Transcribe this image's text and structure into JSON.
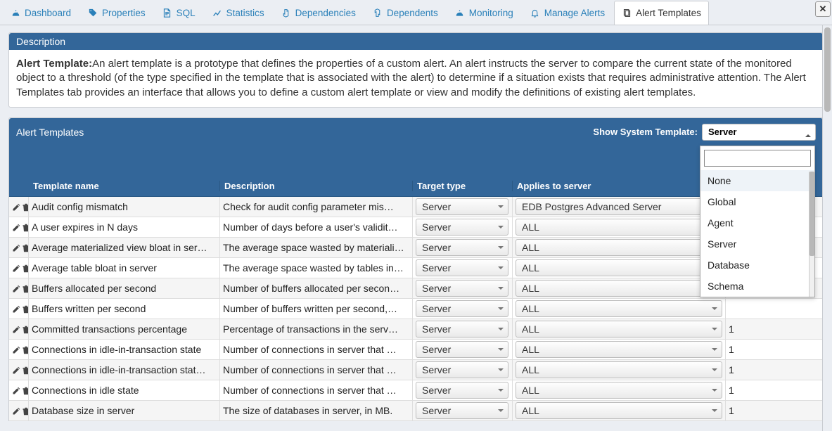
{
  "tabs": [
    {
      "label": "Dashboard",
      "icon": "dashboard-icon"
    },
    {
      "label": "Properties",
      "icon": "tags-icon"
    },
    {
      "label": "SQL",
      "icon": "document-icon"
    },
    {
      "label": "Statistics",
      "icon": "chart-icon"
    },
    {
      "label": "Dependencies",
      "icon": "hand-down-icon"
    },
    {
      "label": "Dependents",
      "icon": "hand-up-icon"
    },
    {
      "label": "Monitoring",
      "icon": "gauge-icon"
    },
    {
      "label": "Manage Alerts",
      "icon": "bell-icon"
    },
    {
      "label": "Alert Templates",
      "icon": "copy-icon",
      "active": true
    }
  ],
  "panels": {
    "description": {
      "title": "Description",
      "lead": "Alert Template:",
      "body": "An alert template is a prototype that defines the properties of a custom alert. An alert instructs the server to compare the current state of the monitored object to a threshold (of the type specified in the template that is associated with the alert) to determine if a situation exists that requires administrative attention. The Alert Templates tab provides an interface that allows you to define a custom alert template or view and modify the definitions of existing alert templates."
    },
    "templates": {
      "title": "Alert Templates",
      "filter_label": "Show System Template:",
      "filter_value": "Server",
      "filter_options": [
        "None",
        "Global",
        "Agent",
        "Server",
        "Database",
        "Schema"
      ],
      "columns": {
        "name": "Template name",
        "desc": "Description",
        "tgt": "Target type",
        "srv": "Applies to server"
      },
      "rows": [
        {
          "name": "Audit config mismatch",
          "desc": "Check for audit config parameter mis…",
          "tgt": "Server",
          "srv": "EDB Postgres Advanced Server",
          "val": ""
        },
        {
          "name": "A user expires in N days",
          "desc": "Number of days before a user's validit…",
          "tgt": "Server",
          "srv": "ALL",
          "val": ""
        },
        {
          "name": "Average materialized view bloat in ser…",
          "desc": "The average space wasted by materiali…",
          "tgt": "Server",
          "srv": "ALL",
          "val": ""
        },
        {
          "name": "Average table bloat in server",
          "desc": "The average space wasted by tables in…",
          "tgt": "Server",
          "srv": "ALL",
          "val": ""
        },
        {
          "name": "Buffers allocated per second",
          "desc": "Number of buffers allocated per secon…",
          "tgt": "Server",
          "srv": "ALL",
          "val": ""
        },
        {
          "name": "Buffers written per second",
          "desc": "Number of buffers written per second,…",
          "tgt": "Server",
          "srv": "ALL",
          "val": ""
        },
        {
          "name": "Committed transactions percentage",
          "desc": "Percentage of transactions in the serv…",
          "tgt": "Server",
          "srv": "ALL",
          "val": "1"
        },
        {
          "name": "Connections in idle-in-transaction state",
          "desc": "Number of connections in server that …",
          "tgt": "Server",
          "srv": "ALL",
          "val": "1"
        },
        {
          "name": "Connections in idle-in-transaction stat…",
          "desc": "Number of connections in server that …",
          "tgt": "Server",
          "srv": "ALL",
          "val": "1"
        },
        {
          "name": "Connections in idle state",
          "desc": "Number of connections in server that …",
          "tgt": "Server",
          "srv": "ALL",
          "val": "1"
        },
        {
          "name": "Database size in server",
          "desc": "The size of databases in server, in MB.",
          "tgt": "Server",
          "srv": "ALL",
          "val": "1"
        }
      ]
    }
  }
}
